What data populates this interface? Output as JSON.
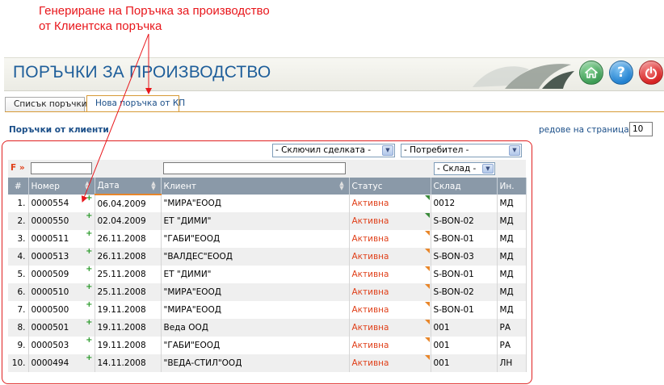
{
  "annotation": {
    "line1": "Генериране на Поръчка за производство",
    "line2": "от Клиентска поръчка"
  },
  "header": {
    "title": "ПОРЪЧКИ ЗА ПРОИЗВОДСТВО",
    "home_icon": "home-icon",
    "help_icon": "help-icon",
    "power_icon": "power-icon",
    "help_symbol": "?"
  },
  "tabs": [
    {
      "label": "Списък поръчки",
      "active": false
    },
    {
      "label": "Нова поръчка от КП",
      "active": true
    }
  ],
  "section": {
    "title": "Поръчки от клиенти",
    "rows_label": "редове на страница",
    "rows_arrow": "»",
    "rows_per_page": "10"
  },
  "filters": {
    "deal_closer": "- Сключил сделката -",
    "consumer": "- Потребител -",
    "warehouse": "- Склад -",
    "f_label": "F »"
  },
  "columns": [
    "#",
    "Номер",
    "Дата",
    "Клиент",
    "Статус",
    "Склад",
    "Ин."
  ],
  "rows": [
    {
      "n": "1.",
      "number": "0000554",
      "date": "06.04.2009",
      "client": "\"МИРА\"ЕООД",
      "status": "Активна",
      "warehouse": "0012",
      "init": "МД",
      "marker": "green"
    },
    {
      "n": "2.",
      "number": "0000550",
      "date": "02.04.2009",
      "client": "ЕТ \"ДИМИ\"",
      "status": "Активна",
      "warehouse": "S-BON-02",
      "init": "МД",
      "marker": "green"
    },
    {
      "n": "3.",
      "number": "0000511",
      "date": "26.11.2008",
      "client": "\"ГАБИ\"ЕООД",
      "status": "Активна",
      "warehouse": "S-BON-01",
      "init": "МД",
      "marker": "orange"
    },
    {
      "n": "4.",
      "number": "0000513",
      "date": "26.11.2008",
      "client": "\"ВАЛДЕС\"ЕООД",
      "status": "Активна",
      "warehouse": "S-BON-03",
      "init": "МД",
      "marker": "orange"
    },
    {
      "n": "5.",
      "number": "0000509",
      "date": "25.11.2008",
      "client": "ЕТ \"ДИМИ\"",
      "status": "Активна",
      "warehouse": "S-BON-01",
      "init": "МД",
      "marker": "orange"
    },
    {
      "n": "6.",
      "number": "0000510",
      "date": "25.11.2008",
      "client": "\"МИРА\"ЕООД",
      "status": "Активна",
      "warehouse": "S-BON-02",
      "init": "МД",
      "marker": "orange"
    },
    {
      "n": "7.",
      "number": "0000500",
      "date": "19.11.2008",
      "client": "\"МИРА\"ЕООД",
      "status": "Активна",
      "warehouse": "S-BON-01",
      "init": "МД",
      "marker": "orange"
    },
    {
      "n": "8.",
      "number": "0000501",
      "date": "19.11.2008",
      "client": "Веда ООД",
      "status": "Активна",
      "warehouse": "001",
      "init": "РА",
      "marker": "orange"
    },
    {
      "n": "9.",
      "number": "0000503",
      "date": "19.11.2008",
      "client": "\"ГАБИ\"ЕООД",
      "status": "Активна",
      "warehouse": "001",
      "init": "РА",
      "marker": "orange"
    },
    {
      "n": "10.",
      "number": "0000494",
      "date": "14.11.2008",
      "client": "\"ВЕДА-СТИЛ\"ООД",
      "status": "Активна",
      "warehouse": "001",
      "init": "ЛН",
      "marker": "orange"
    }
  ],
  "colors": {
    "title_blue": "#1e5e9a",
    "annotation_red": "#e8161b",
    "status_red": "#e0401a",
    "header_row": "#8a99a8",
    "tab_accent": "#d79a36"
  }
}
